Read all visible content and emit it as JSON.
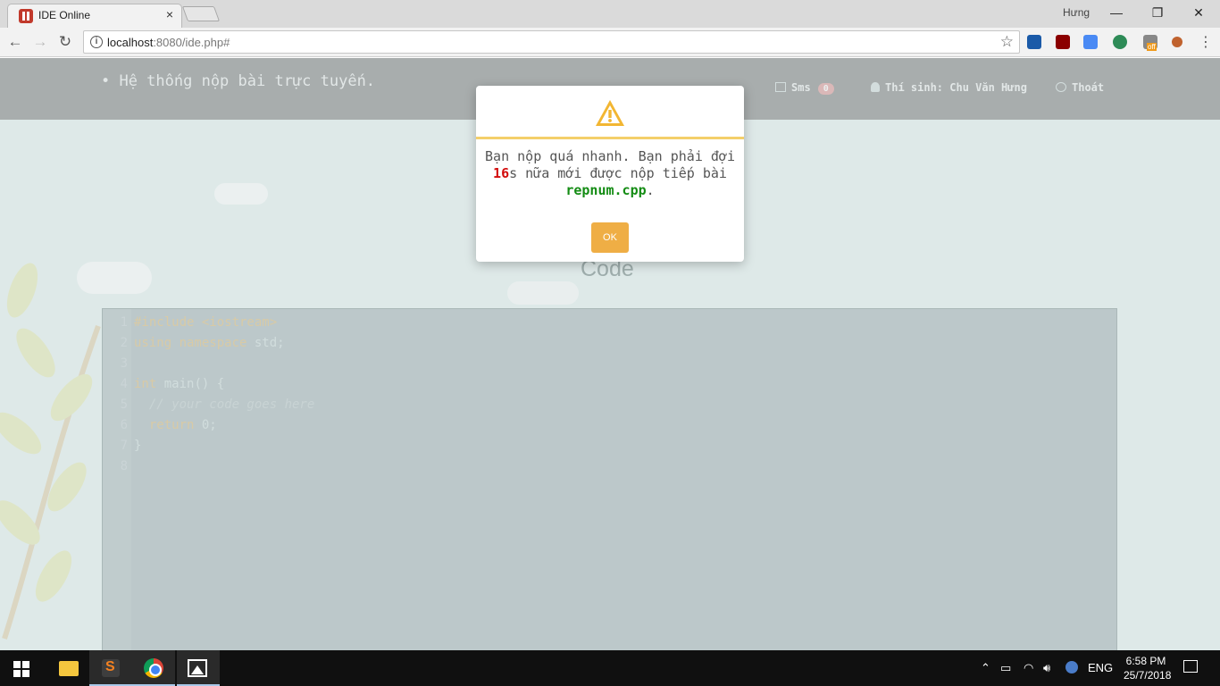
{
  "browser": {
    "tab_title": "IDE Online",
    "tab_close": "×",
    "profile_name": "Hưng",
    "window_min": "—",
    "window_max": "❐",
    "window_close": "✕",
    "nav_back": "←",
    "nav_forward": "→",
    "nav_reload": "↻",
    "url_host": "localhost",
    "url_rest": ":8080/ide.php#",
    "star": "☆",
    "ext_off_badge": "off",
    "menu": "⋮"
  },
  "navbar": {
    "brand": "• Hệ thống nộp bài trực tuyến.",
    "sms_label": "Sms",
    "sms_count": "0",
    "user_label": "Thí sinh: Chu Văn Hưng",
    "logout_label": "Thoát"
  },
  "main": {
    "code_heading": "Code"
  },
  "editor": {
    "lines": [
      {
        "num": "1",
        "html": "<span class=\"inc\">#include &lt;iostream&gt;</span>"
      },
      {
        "num": "2",
        "html": "<span class=\"kw\">using namespace</span> std;"
      },
      {
        "num": "3",
        "html": ""
      },
      {
        "num": "4",
        "html": "<span class=\"kw\">int</span> main() {"
      },
      {
        "num": "5",
        "html": "  <span class=\"com\">// your code goes here</span>"
      },
      {
        "num": "6",
        "html": "  <span class=\"kw\">return</span> 0;"
      },
      {
        "num": "7",
        "html": "}"
      },
      {
        "num": "8",
        "html": ""
      }
    ]
  },
  "modal": {
    "msg_part1": "Bạn nộp quá nhanh. Bạn phải đợi ",
    "seconds": "16",
    "msg_part2": "s nữa mới được nộp tiếp bài ",
    "filename": "repnum.cpp",
    "msg_part3": ".",
    "ok_label": "OK",
    "accent_color": "#efae45",
    "icon": "warning-icon"
  },
  "taskbar": {
    "language": "ENG",
    "time": "6:58 PM",
    "date": "25/7/2018"
  }
}
